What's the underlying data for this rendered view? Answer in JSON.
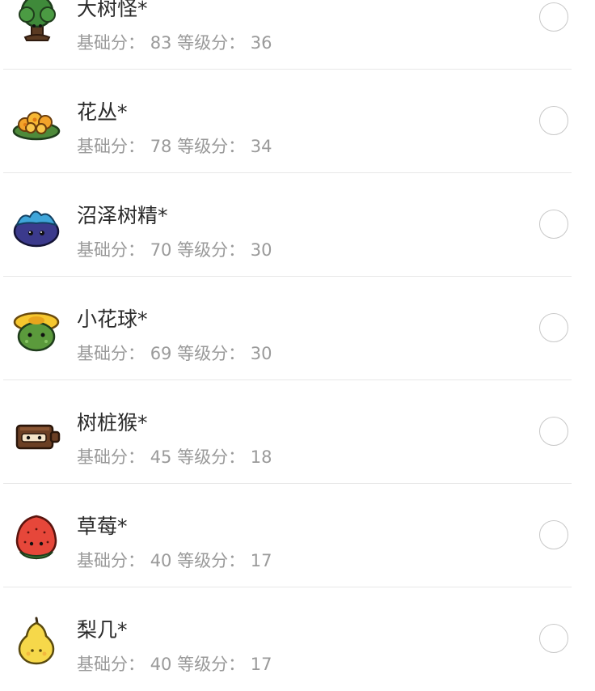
{
  "monsters": [
    {
      "name": "大树怪*",
      "base_label": "基础分：",
      "base": "83",
      "level_label": "等级分：",
      "level": "36",
      "icon": "tree-monster-icon"
    },
    {
      "name": "花丛*",
      "base_label": "基础分：",
      "base": "78",
      "level_label": "等级分：",
      "level": "34",
      "icon": "flower-bush-icon"
    },
    {
      "name": "沼泽树精*",
      "base_label": "基础分：",
      "base": "70",
      "level_label": "等级分：",
      "level": "30",
      "icon": "swamp-spirit-icon"
    },
    {
      "name": "小花球*",
      "base_label": "基础分：",
      "base": "69",
      "level_label": "等级分：",
      "level": "30",
      "icon": "flower-ball-icon"
    },
    {
      "name": "树桩猴*",
      "base_label": "基础分：",
      "base": "45",
      "level_label": "等级分：",
      "level": "18",
      "icon": "stump-monkey-icon"
    },
    {
      "name": "草莓*",
      "base_label": "基础分：",
      "base": "40",
      "level_label": "等级分：",
      "level": "17",
      "icon": "strawberry-icon"
    },
    {
      "name": "梨几*",
      "base_label": "基础分：",
      "base": "40",
      "level_label": "等级分：",
      "level": "17",
      "icon": "pear-icon"
    }
  ]
}
